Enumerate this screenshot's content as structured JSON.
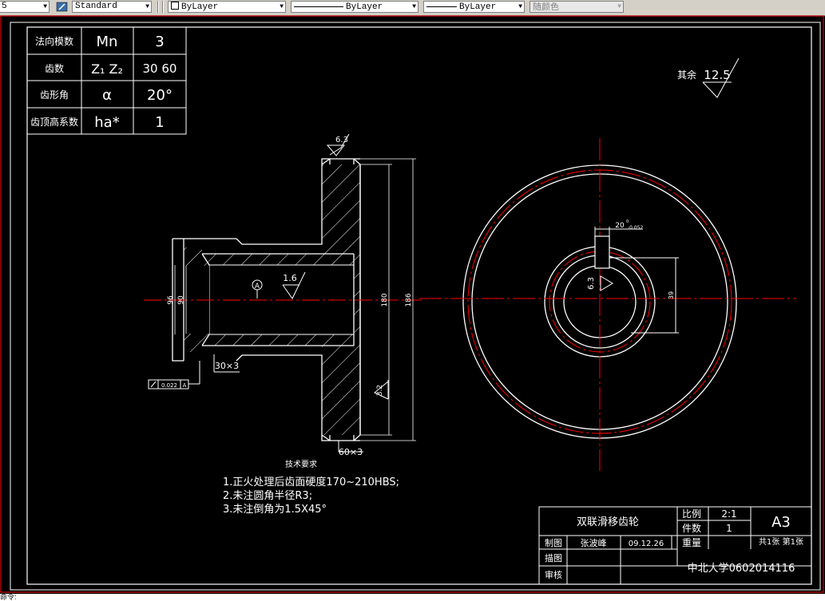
{
  "toolbar": {
    "left_fragment": "5",
    "text_style": "Standard",
    "layer": "ByLayer",
    "linetype": "ByLayer",
    "lineweight": "ByLayer",
    "plot_style": "随颜色"
  },
  "params_table": {
    "rows": [
      {
        "label": "法向模数",
        "symbol": "Mn",
        "value": "3"
      },
      {
        "label": "齿数",
        "symbol": "Z₁ Z₂",
        "value": "30 60"
      },
      {
        "label": "齿形角",
        "symbol": "α",
        "value": "20°"
      },
      {
        "label": "齿顶高系数",
        "symbol": "ha*",
        "value": "1"
      }
    ]
  },
  "surface_note": {
    "label": "其余",
    "value": "12.5"
  },
  "dimensions": {
    "roughness_top": "6.3",
    "roughness_bore": "1.6",
    "roughness_face": "3.2",
    "datum": "A",
    "tolerance_value": "0.022",
    "tolerance_datum": "A",
    "dia_96": "96",
    "dia_90": "90",
    "dia_180": "180",
    "dia_186": "186",
    "chamfer_left": "30×3",
    "chamfer_bottom": "60×3",
    "keyway_width": "20",
    "keyway_tol_upper": "0",
    "keyway_tol_lower": "-0.052",
    "keyway_rough": "6.3",
    "keyway_depth": "39"
  },
  "technical_requirements": {
    "title": "技术要求",
    "items": [
      "1.正火处理后齿面硬度170~210HBS;",
      "2.未注圆角半径R3;",
      "3.未注倒角为1.5X45°"
    ]
  },
  "title_block": {
    "part_name": "双联滑移齿轮",
    "scale_label": "比例",
    "scale_value": "2:1",
    "qty_label": "件数",
    "qty_value": "1",
    "weight_label": "重量",
    "sheet_size": "A3",
    "sheet_info": "共1张  第1张",
    "drawn_label": "制图",
    "drawn_name": "张波峰",
    "drawn_date": "09.12.26",
    "traced_label": "描图",
    "checked_label": "审核",
    "organization": "中北大学0602014116"
  },
  "command_line": "命令:",
  "colors": {
    "background": "#000000",
    "lines": "#ffffff",
    "center_lines": "#ff0000",
    "border": "#ff0000"
  }
}
